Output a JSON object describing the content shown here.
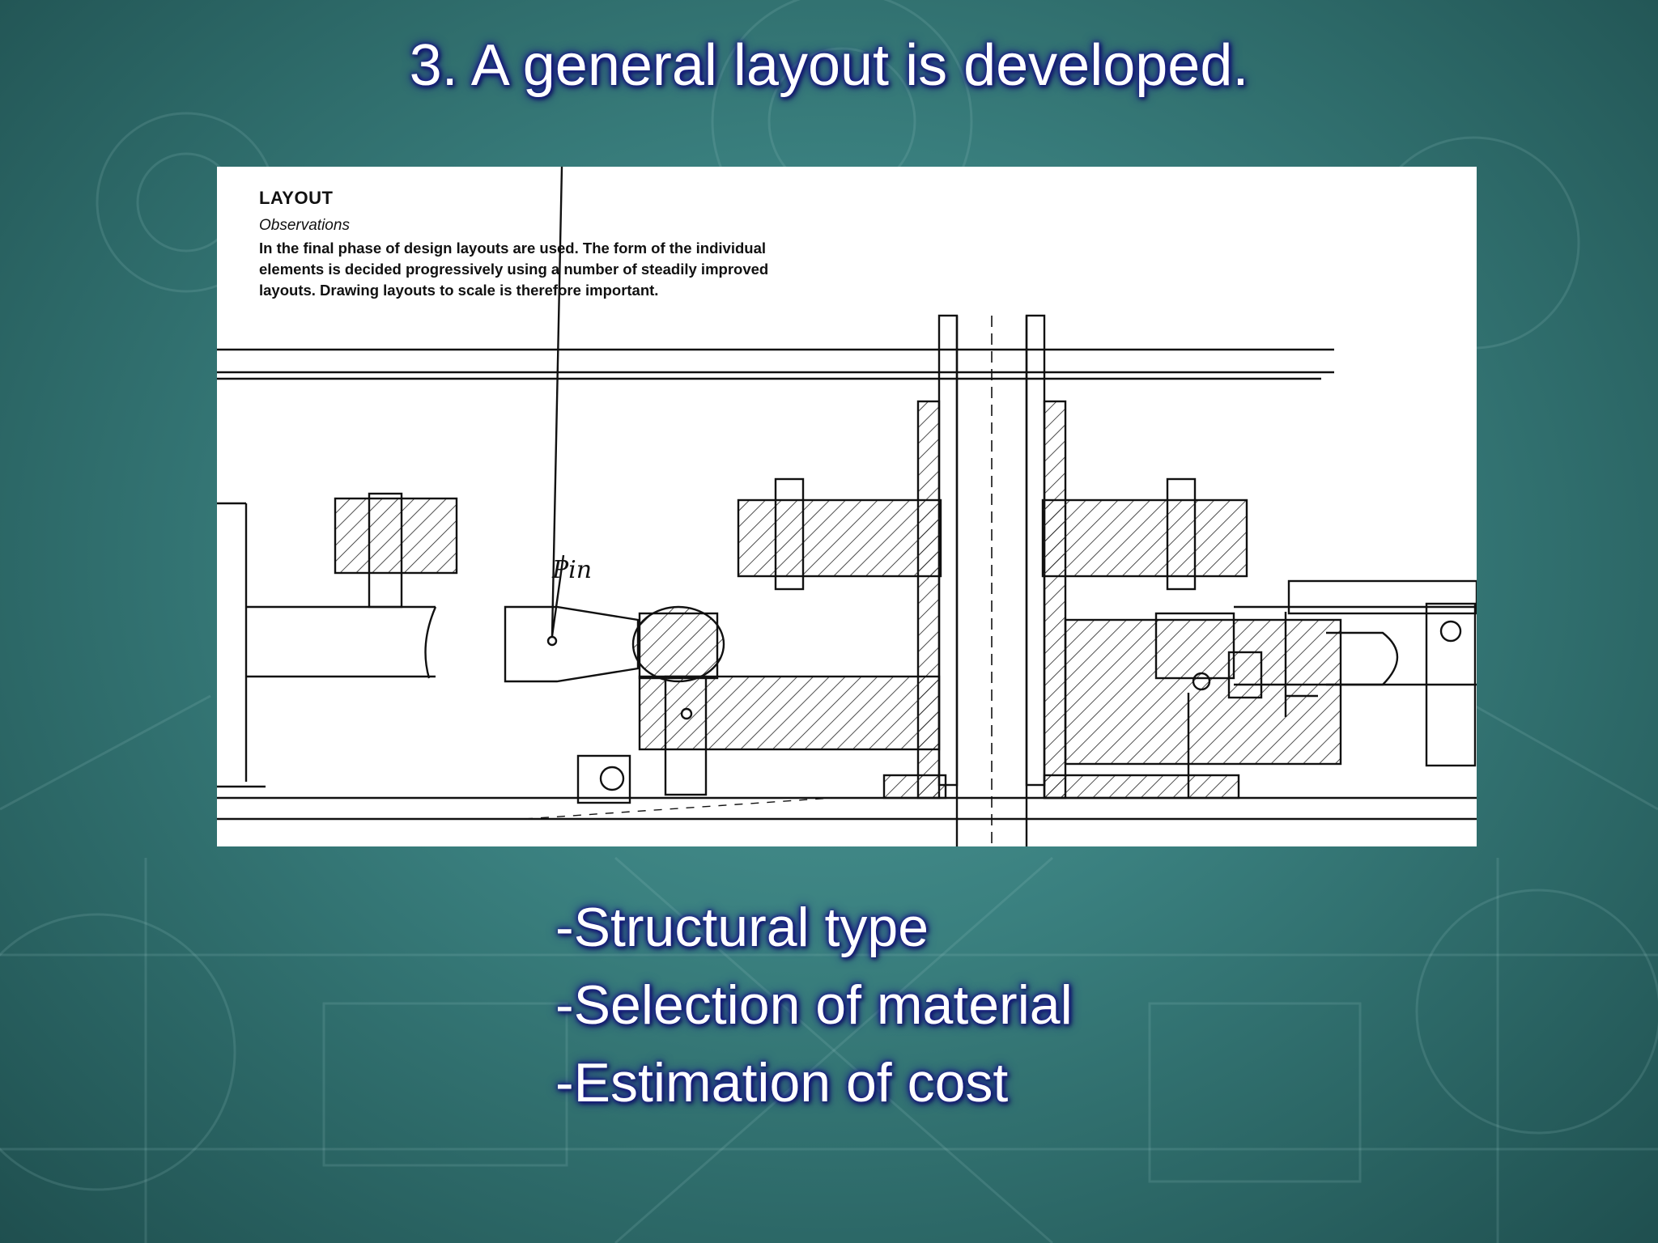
{
  "slide": {
    "title": "3. A general layout is developed."
  },
  "figure": {
    "heading": "LAYOUT",
    "subheading": "Observations",
    "text": "In the final phase of design layouts are used. The form of the individual elements is decided progressively using a number of steadily improved layouts. Drawing layouts to scale is therefore important.",
    "annotation": "Pin"
  },
  "bullets": [
    "-Structural type",
    "-Selection of material",
    "-Estimation of cost"
  ],
  "colors": {
    "background": "#3a807f",
    "title_text": "#ffffff",
    "text_glow": "#1a1a8a"
  }
}
